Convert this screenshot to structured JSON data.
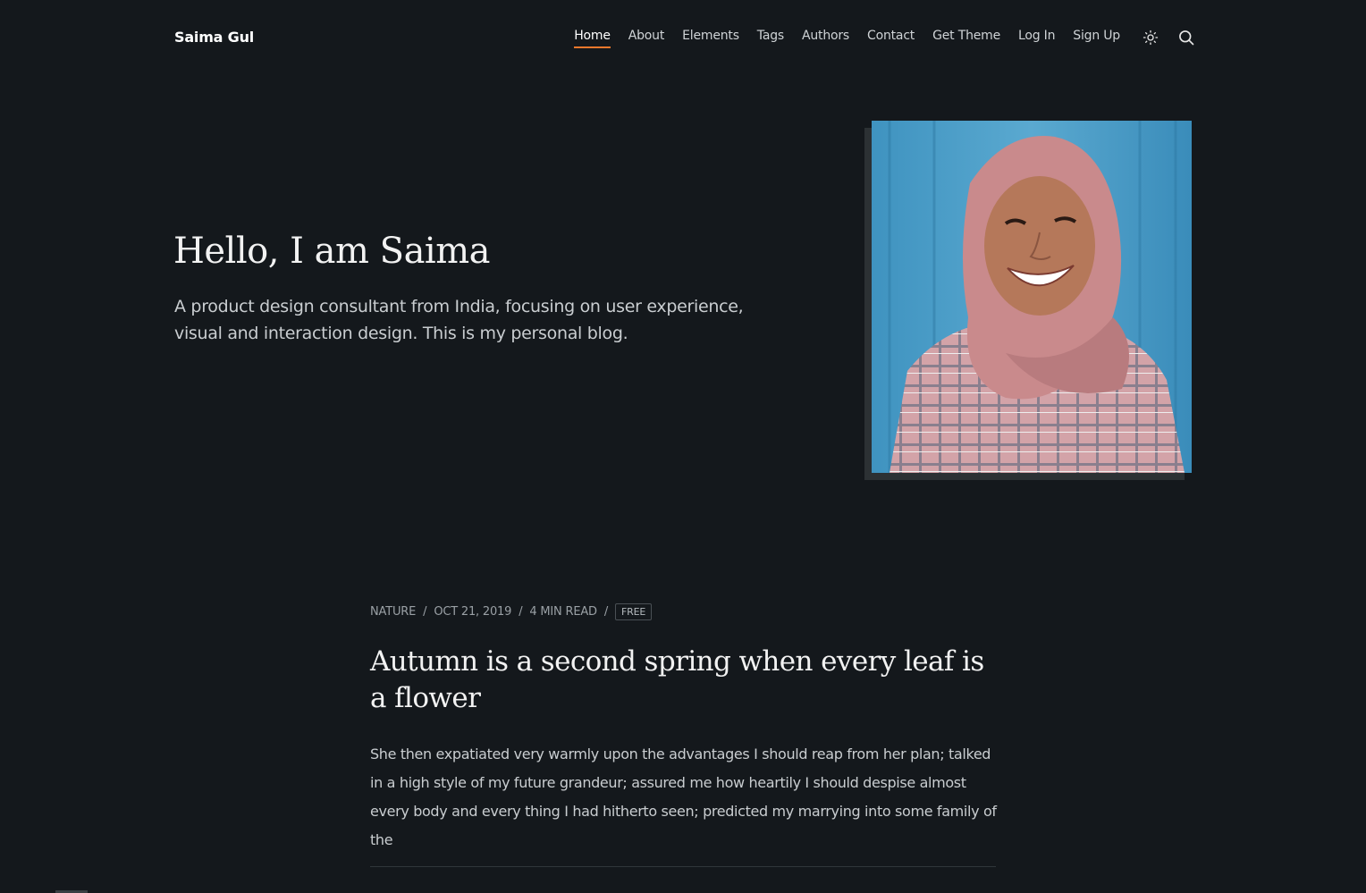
{
  "header": {
    "brand": "Saima Gul",
    "nav": [
      {
        "label": "Home",
        "active": true
      },
      {
        "label": "About"
      },
      {
        "label": "Elements"
      },
      {
        "label": "Tags"
      },
      {
        "label": "Authors"
      },
      {
        "label": "Contact"
      },
      {
        "label": "Get Theme"
      },
      {
        "label": "Log In"
      },
      {
        "label": "Sign Up"
      }
    ],
    "icons": [
      "sun-icon",
      "search-icon"
    ]
  },
  "hero": {
    "title": "Hello, I am Saima",
    "description": "A product design consultant from India, focusing on user experience, visual and interaction design. This is my personal blog.",
    "image": "portrait-photo"
  },
  "post": {
    "tag": "NATURE",
    "date": "OCT 21, 2019",
    "read_time": "4 MIN READ",
    "badge": "FREE",
    "separator": "/",
    "title": "Autumn is a second spring when every leaf is a flower",
    "excerpt": "She then expatiated very warmly upon the advantages I should reap from her plan; talked in a high style of my future grandeur; assured me how heartily I should despise almost every body and every thing I had hitherto seen; predicted my marrying into some family of the"
  },
  "colors": {
    "background": "#14181c",
    "accent": "#f0782c",
    "text": "#e6e6e6",
    "muted": "#9aa0a5"
  }
}
